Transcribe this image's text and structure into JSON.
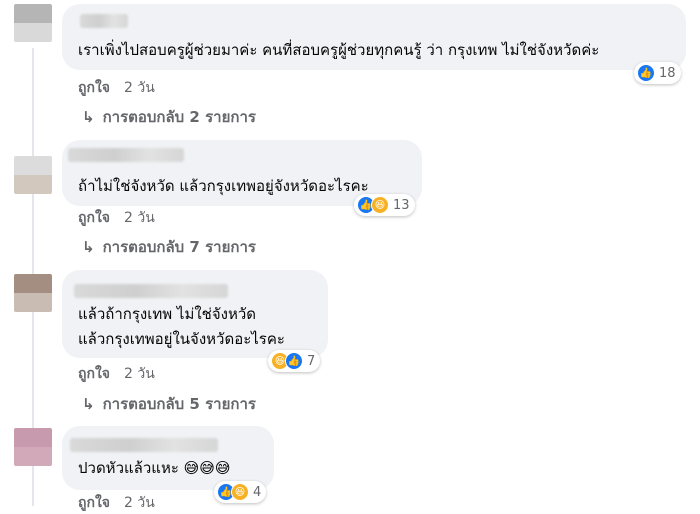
{
  "comments": [
    {
      "text_lines": [
        "เราเพิ่งไปสอบครูผู้ช่วยมาค่ะ คนที่สอบครูผู้ช่วยทุกคนรู้ ว่า กรุงเทพ ไม่ใช่จังหวัดค่ะ"
      ],
      "reaction_count": "18",
      "like_label": "ถูกใจ",
      "time": "2 วัน",
      "replies_label": "การตอบกลับ 2 รายการ"
    },
    {
      "text_lines": [
        "ถ้าไม่ใช่จังหวัด แล้วกรุงเทพอยู่จังหวัดอะไรคะ"
      ],
      "reaction_count": "13",
      "like_label": "ถูกใจ",
      "time": "2 วัน",
      "replies_label": "การตอบกลับ 7 รายการ"
    },
    {
      "text_lines": [
        "แล้วถ้ากรุงเทพ ไม่ใช่จังหวัด",
        "แล้วกรุงเทพอยู่ในจังหวัดอะไรคะ"
      ],
      "reaction_count": "7",
      "like_label": "ถูกใจ",
      "time": "2 วัน",
      "replies_label": "การตอบกลับ 5 รายการ"
    },
    {
      "text_lines": [
        "ปวดหัวแล้วแหะ 😅😅😅"
      ],
      "reaction_count": "4",
      "like_label": "ถูกใจ",
      "time": "2 วัน"
    }
  ],
  "icons": {
    "like": "thumbs-up-icon",
    "haha": "laughing-face-icon",
    "reply_arrow": "reply-arrow-icon"
  },
  "colors": {
    "bubble": "#f0f2f5",
    "meta_text": "#65676b",
    "like_blue": "#1877f2",
    "haha_yellow": "#f7b125"
  }
}
